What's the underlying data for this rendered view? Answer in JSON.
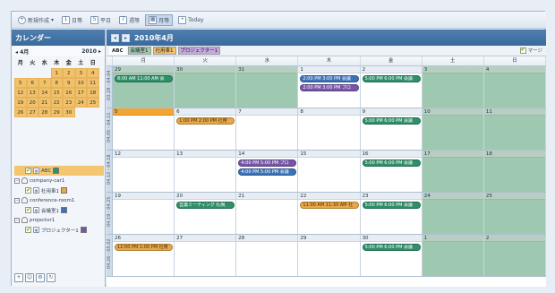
{
  "toolbar": {
    "buttons": [
      {
        "label": "新規作成",
        "icon": "plus-icon"
      },
      {
        "label": "日等",
        "icon": "day-view-icon"
      },
      {
        "label": "平日",
        "icon": "weekday-view-icon"
      },
      {
        "label": "週等",
        "icon": "week-view-icon"
      },
      {
        "label": "月等",
        "icon": "month-view-icon"
      },
      {
        "label": "Today",
        "icon": "today-icon"
      }
    ]
  },
  "sidebar": {
    "title": "カレンダー",
    "mini": {
      "month": "4月",
      "year": "2010",
      "dow": [
        "月",
        "火",
        "水",
        "木",
        "金",
        "土",
        "日"
      ],
      "weeks": [
        [
          "",
          "",
          "",
          "1",
          "2",
          "3",
          "4"
        ],
        [
          "5",
          "6",
          "7",
          "8",
          "9",
          "10",
          "11"
        ],
        [
          "12",
          "13",
          "14",
          "15",
          "16",
          "17",
          "18"
        ],
        [
          "19",
          "20",
          "21",
          "22",
          "23",
          "24",
          "25"
        ],
        [
          "26",
          "27",
          "28",
          "29",
          "30",
          "",
          ""
        ]
      ]
    },
    "calendars": [
      {
        "label": "ABC",
        "color": "#2f8f6a"
      },
      {
        "group": "company-car1",
        "label": "社用車1",
        "color": "#e7a84a"
      },
      {
        "group": "conference-room1",
        "label": "会議室1",
        "color": "#3c73b8"
      },
      {
        "group": "projector1",
        "label": "プロジェクター1",
        "color": "#7756a8"
      }
    ]
  },
  "main": {
    "title": "2010年4月",
    "tabs": [
      {
        "label": "ABC",
        "color": "#ffffff"
      },
      {
        "label": "会議室1",
        "color": "#9ec9b0"
      },
      {
        "label": "社用車1",
        "color": "#f1c16b"
      },
      {
        "label": "プロジェクター1",
        "color": "#c7a9e0"
      }
    ],
    "merge_label": "マージ",
    "dow": [
      "月",
      "火",
      "水",
      "木",
      "金",
      "土",
      "日"
    ],
    "weeks": [
      {
        "label": "03.29 - 04.04",
        "days": [
          "29",
          "30",
          "31",
          "1",
          "2",
          "3",
          "4"
        ]
      },
      {
        "label": "04.05 - 04.11",
        "days": [
          "5",
          "6",
          "7",
          "8",
          "9",
          "10",
          "11"
        ]
      },
      {
        "label": "04.12 - 04.18",
        "days": [
          "12",
          "13",
          "14",
          "15",
          "16",
          "17",
          "18"
        ]
      },
      {
        "label": "04.19 - 04.25",
        "days": [
          "19",
          "20",
          "21",
          "22",
          "23",
          "24",
          "25"
        ]
      },
      {
        "label": "04.26 - 05.02",
        "days": [
          "26",
          "27",
          "28",
          "29",
          "30",
          "1",
          "2"
        ]
      }
    ],
    "events": {
      "w0_mon": "8:00 AM 11:00 AM 会",
      "w0_thu_a": "2:00 PM 3:00 PM 会議",
      "w0_thu_b": "2:00 PM 3:00 PM プロ",
      "w0_fri": "5:00 PM 6:00 PM 会議",
      "w1_tue": "1:00 PM 2:00 PM 社用",
      "w1_fri": "5:00 PM 6:00 PM 会議",
      "w2_wed_a": "4:00 PM 5:00 PM プロ",
      "w2_wed_b": "4:00 PM 5:00 PM 会議",
      "w2_fri": "5:00 PM 6:00 PM 会議",
      "w3_tue": "営業ミーティング 札幌",
      "w3_thu": "11:00 AM 11:30 AM 社",
      "w3_fri": "5:00 PM 6:00 PM 会議",
      "w4_mon": "12:00 PM 1:00 PM 社用",
      "w4_fri": "5:00 PM 6:00 PM 会議"
    }
  }
}
